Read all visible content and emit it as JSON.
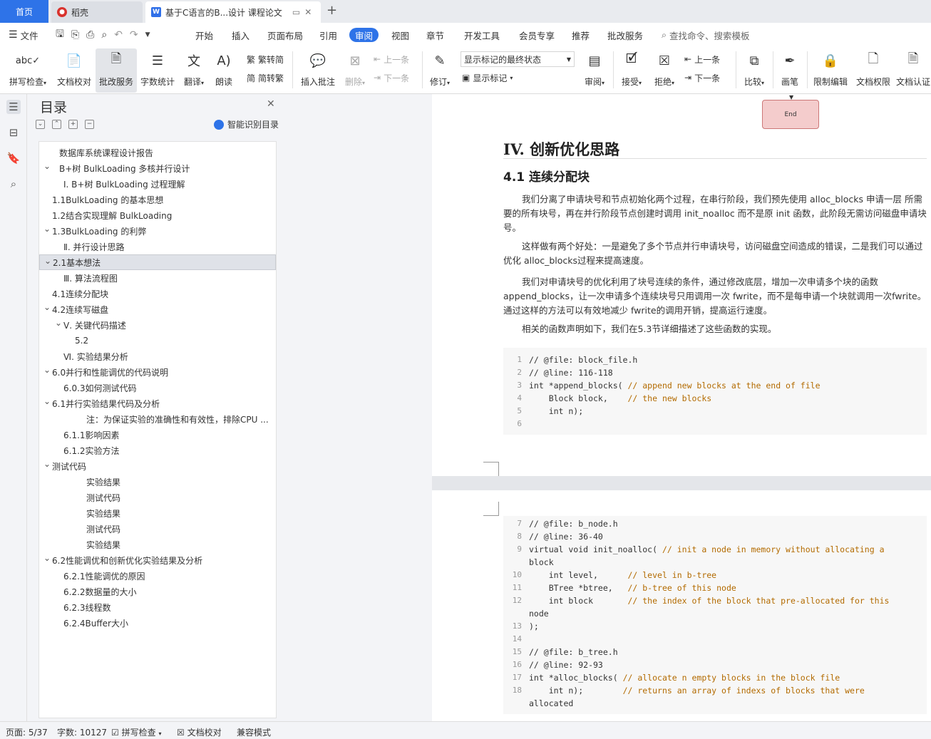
{
  "tabs": {
    "home": "首页",
    "daoke": "稻壳",
    "doc": "基于C语言的B...设计 课程论文"
  },
  "menu": {
    "file": "文件",
    "items": [
      "开始",
      "插入",
      "页面布局",
      "引用",
      "审阅",
      "视图",
      "章节",
      "开发工具",
      "会员专享",
      "推荐",
      "批改服务"
    ],
    "active": "审阅",
    "search": "查找命令、搜索模板"
  },
  "ribbon": {
    "spell": "拼写检查",
    "proof": "文档校对",
    "review_service": "批改服务",
    "word_count": "字数统计",
    "translate": "翻译",
    "read_aloud": "朗读",
    "to_trad": "繁转简",
    "to_simp": "简转繁",
    "insert_comment": "插入批注",
    "delete": "删除",
    "prev": "上一条",
    "next": "下一条",
    "track": "修订",
    "markup_select": "显示标记的最终状态",
    "show_markup": "显示标记",
    "review": "审阅",
    "accept": "接受",
    "reject": "拒绝",
    "prev2": "上一条",
    "next2": "下一条",
    "compare": "比较",
    "pen": "画笔",
    "restrict": "限制编辑",
    "permission": "文档权限",
    "certify": "文档认证"
  },
  "toc": {
    "title": "目录",
    "smart": "智能识别目录",
    "items": [
      {
        "text": "数据库系统课程设计报告",
        "level": 1,
        "chev": false
      },
      {
        "text": "B+树 BulkLoading 多核并行设计",
        "level": 1,
        "chev": true
      },
      {
        "text": "Ⅰ. B+树 BulkLoading 过程理解",
        "level": 2,
        "chev": false
      },
      {
        "text": "1.1BulkLoading 的基本思想",
        "level": 0,
        "chev": false
      },
      {
        "text": "1.2结合实现理解 BulkLoading",
        "level": 0,
        "chev": false
      },
      {
        "text": "1.3BulkLoading 的利弊",
        "level": 0,
        "chev": true
      },
      {
        "text": "Ⅱ. 并行设计思路",
        "level": 2,
        "chev": false
      },
      {
        "text": "2.1基本想法",
        "level": 0,
        "chev": true,
        "selected": true
      },
      {
        "text": "Ⅲ. 算法流程图",
        "level": 2,
        "chev": false
      },
      {
        "text": "4.1连续分配块",
        "level": 0,
        "chev": false
      },
      {
        "text": "4.2连续写磁盘",
        "level": 0,
        "chev": true
      },
      {
        "text": "Ⅴ. 关键代码描述",
        "level": 2,
        "chev": true
      },
      {
        "text": "5.2",
        "level": 3,
        "chev": false
      },
      {
        "text": "Ⅵ. 实验结果分析",
        "level": 2,
        "chev": false
      },
      {
        "text": "6.0并行和性能调优的代码说明",
        "level": 0,
        "chev": true
      },
      {
        "text": "6.0.3如何测试代码",
        "level": 2,
        "chev": false
      },
      {
        "text": "6.1并行实验结果代码及分析",
        "level": 0,
        "chev": true
      },
      {
        "text": "注：为保证实验的准确性和有效性，排除CPU ...",
        "level": 4,
        "chev": false
      },
      {
        "text": "6.1.1影响因素",
        "level": 2,
        "chev": false
      },
      {
        "text": "6.1.2实验方法",
        "level": 2,
        "chev": false
      },
      {
        "text": "测试代码",
        "level": 0,
        "chev": true
      },
      {
        "text": "实验结果",
        "level": 4,
        "chev": false
      },
      {
        "text": "测试代码",
        "level": 4,
        "chev": false
      },
      {
        "text": "实验结果",
        "level": 4,
        "chev": false
      },
      {
        "text": "测试代码",
        "level": 4,
        "chev": false
      },
      {
        "text": "实验结果",
        "level": 4,
        "chev": false
      },
      {
        "text": "6.2性能调优和创新优化实验结果及分析",
        "level": 0,
        "chev": true
      },
      {
        "text": "6.2.1性能调优的原因",
        "level": 2,
        "chev": false
      },
      {
        "text": "6.2.2数据量的大小",
        "level": 2,
        "chev": false
      },
      {
        "text": "6.2.3线程数",
        "level": 2,
        "chev": false
      },
      {
        "text": "6.2.4Buffer大小",
        "level": 2,
        "chev": false
      }
    ]
  },
  "doc": {
    "end_label": "End",
    "h1": "IV. 创新优化思路",
    "h2": "4.1 连续分配块",
    "p1": "我们分离了申请块号和节点初始化两个过程，在串行阶段，我们预先使用 alloc_blocks 申请一层 所需要的所有块号，再在并行阶段节点创建时调用 init_noalloc 而不是原 init 函数，此阶段无需访问磁盘申请块号。",
    "p2": "这样做有两个好处：一是避免了多个节点并行申请块号，访问磁盘空间造成的错误，二是我们可以通过优化 alloc_blocks过程来提高速度。",
    "p3": "我们对申请块号的优化利用了块号连续的条件，通过修改底层，增加一次申请多个块的函数 append_blocks，让一次申请多个连续块号只用调用一次 fwrite，而不是每申请一个块就调用一次fwrite。通过这样的方法可以有效地减少 fwrite的调用开销，提高运行速度。",
    "p4": "相关的函数声明如下，我们在5.3节详细描述了这些函数的实现。",
    "code1": [
      {
        "n": "1",
        "t": "// @file: block_file.h",
        "c": "cm"
      },
      {
        "n": "2",
        "t": "// @line: 116-118",
        "c": "cm"
      },
      {
        "n": "3",
        "t": "int *append_blocks( // append new blocks at the end of file",
        "c": "mix1"
      },
      {
        "n": "4",
        "t": "    Block block,    // the new blocks",
        "c": "mix2"
      },
      {
        "n": "5",
        "t": "    int n);",
        "c": "mix3"
      },
      {
        "n": "6",
        "t": "",
        "c": ""
      }
    ],
    "code2": [
      {
        "n": "7",
        "t": "// @file: b_node.h",
        "c": "cm"
      },
      {
        "n": "8",
        "t": "// @line: 36-40",
        "c": "cm"
      },
      {
        "n": "9",
        "t": "virtual void init_noalloc( // init a node in memory without allocating a",
        "c": "mix4"
      },
      {
        "n": "",
        "t": "block",
        "c": "cm"
      },
      {
        "n": "10",
        "t": "    int level,      // level in b-tree",
        "c": "mix5"
      },
      {
        "n": "11",
        "t": "    BTree *btree,   // b-tree of this node",
        "c": "mix6"
      },
      {
        "n": "12",
        "t": "    int block       // the index of the block that pre-allocated for this",
        "c": "mix7"
      },
      {
        "n": "",
        "t": "node",
        "c": "cm"
      },
      {
        "n": "13",
        "t": ");",
        "c": ""
      },
      {
        "n": "14",
        "t": "",
        "c": ""
      },
      {
        "n": "15",
        "t": "// @file: b_tree.h",
        "c": "cm"
      },
      {
        "n": "16",
        "t": "// @line: 92-93",
        "c": "cm"
      },
      {
        "n": "17",
        "t": "int *alloc_blocks( // allocate n empty blocks in the block file",
        "c": "mix8"
      },
      {
        "n": "18",
        "t": "    int n);        // returns an array of indexs of blocks that were",
        "c": "mix9"
      },
      {
        "n": "",
        "t": "allocated",
        "c": "cm"
      }
    ]
  },
  "status": {
    "page": "页面: 5/37",
    "words": "字数: 10127",
    "spell": "拼写检查",
    "proof": "文档校对",
    "compat": "兼容模式"
  }
}
